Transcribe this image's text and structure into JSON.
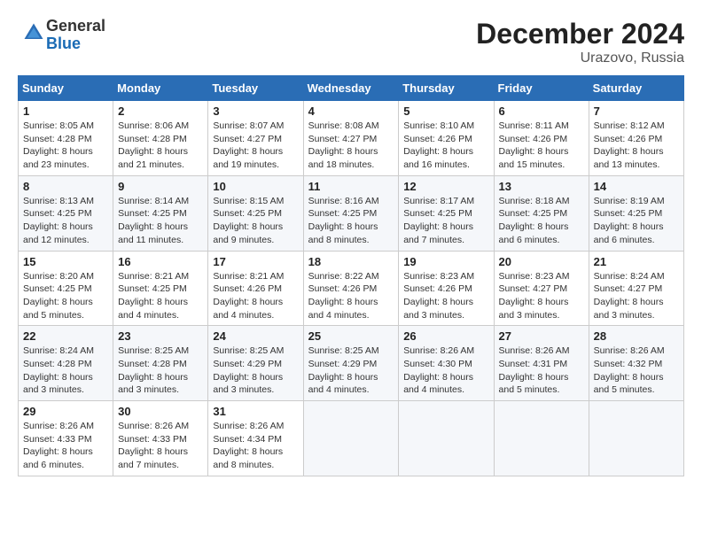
{
  "logo": {
    "general": "General",
    "blue": "Blue"
  },
  "header": {
    "month_year": "December 2024",
    "location": "Urazovo, Russia"
  },
  "weekdays": [
    "Sunday",
    "Monday",
    "Tuesday",
    "Wednesday",
    "Thursday",
    "Friday",
    "Saturday"
  ],
  "weeks": [
    [
      {
        "day": "1",
        "sunrise": "8:05 AM",
        "sunset": "4:28 PM",
        "daylight": "8 hours and 23 minutes."
      },
      {
        "day": "2",
        "sunrise": "8:06 AM",
        "sunset": "4:28 PM",
        "daylight": "8 hours and 21 minutes."
      },
      {
        "day": "3",
        "sunrise": "8:07 AM",
        "sunset": "4:27 PM",
        "daylight": "8 hours and 19 minutes."
      },
      {
        "day": "4",
        "sunrise": "8:08 AM",
        "sunset": "4:27 PM",
        "daylight": "8 hours and 18 minutes."
      },
      {
        "day": "5",
        "sunrise": "8:10 AM",
        "sunset": "4:26 PM",
        "daylight": "8 hours and 16 minutes."
      },
      {
        "day": "6",
        "sunrise": "8:11 AM",
        "sunset": "4:26 PM",
        "daylight": "8 hours and 15 minutes."
      },
      {
        "day": "7",
        "sunrise": "8:12 AM",
        "sunset": "4:26 PM",
        "daylight": "8 hours and 13 minutes."
      }
    ],
    [
      {
        "day": "8",
        "sunrise": "8:13 AM",
        "sunset": "4:25 PM",
        "daylight": "8 hours and 12 minutes."
      },
      {
        "day": "9",
        "sunrise": "8:14 AM",
        "sunset": "4:25 PM",
        "daylight": "8 hours and 11 minutes."
      },
      {
        "day": "10",
        "sunrise": "8:15 AM",
        "sunset": "4:25 PM",
        "daylight": "8 hours and 9 minutes."
      },
      {
        "day": "11",
        "sunrise": "8:16 AM",
        "sunset": "4:25 PM",
        "daylight": "8 hours and 8 minutes."
      },
      {
        "day": "12",
        "sunrise": "8:17 AM",
        "sunset": "4:25 PM",
        "daylight": "8 hours and 7 minutes."
      },
      {
        "day": "13",
        "sunrise": "8:18 AM",
        "sunset": "4:25 PM",
        "daylight": "8 hours and 6 minutes."
      },
      {
        "day": "14",
        "sunrise": "8:19 AM",
        "sunset": "4:25 PM",
        "daylight": "8 hours and 6 minutes."
      }
    ],
    [
      {
        "day": "15",
        "sunrise": "8:20 AM",
        "sunset": "4:25 PM",
        "daylight": "8 hours and 5 minutes."
      },
      {
        "day": "16",
        "sunrise": "8:21 AM",
        "sunset": "4:25 PM",
        "daylight": "8 hours and 4 minutes."
      },
      {
        "day": "17",
        "sunrise": "8:21 AM",
        "sunset": "4:26 PM",
        "daylight": "8 hours and 4 minutes."
      },
      {
        "day": "18",
        "sunrise": "8:22 AM",
        "sunset": "4:26 PM",
        "daylight": "8 hours and 4 minutes."
      },
      {
        "day": "19",
        "sunrise": "8:23 AM",
        "sunset": "4:26 PM",
        "daylight": "8 hours and 3 minutes."
      },
      {
        "day": "20",
        "sunrise": "8:23 AM",
        "sunset": "4:27 PM",
        "daylight": "8 hours and 3 minutes."
      },
      {
        "day": "21",
        "sunrise": "8:24 AM",
        "sunset": "4:27 PM",
        "daylight": "8 hours and 3 minutes."
      }
    ],
    [
      {
        "day": "22",
        "sunrise": "8:24 AM",
        "sunset": "4:28 PM",
        "daylight": "8 hours and 3 minutes."
      },
      {
        "day": "23",
        "sunrise": "8:25 AM",
        "sunset": "4:28 PM",
        "daylight": "8 hours and 3 minutes."
      },
      {
        "day": "24",
        "sunrise": "8:25 AM",
        "sunset": "4:29 PM",
        "daylight": "8 hours and 3 minutes."
      },
      {
        "day": "25",
        "sunrise": "8:25 AM",
        "sunset": "4:29 PM",
        "daylight": "8 hours and 4 minutes."
      },
      {
        "day": "26",
        "sunrise": "8:26 AM",
        "sunset": "4:30 PM",
        "daylight": "8 hours and 4 minutes."
      },
      {
        "day": "27",
        "sunrise": "8:26 AM",
        "sunset": "4:31 PM",
        "daylight": "8 hours and 5 minutes."
      },
      {
        "day": "28",
        "sunrise": "8:26 AM",
        "sunset": "4:32 PM",
        "daylight": "8 hours and 5 minutes."
      }
    ],
    [
      {
        "day": "29",
        "sunrise": "8:26 AM",
        "sunset": "4:33 PM",
        "daylight": "8 hours and 6 minutes."
      },
      {
        "day": "30",
        "sunrise": "8:26 AM",
        "sunset": "4:33 PM",
        "daylight": "8 hours and 7 minutes."
      },
      {
        "day": "31",
        "sunrise": "8:26 AM",
        "sunset": "4:34 PM",
        "daylight": "8 hours and 8 minutes."
      },
      null,
      null,
      null,
      null
    ]
  ]
}
